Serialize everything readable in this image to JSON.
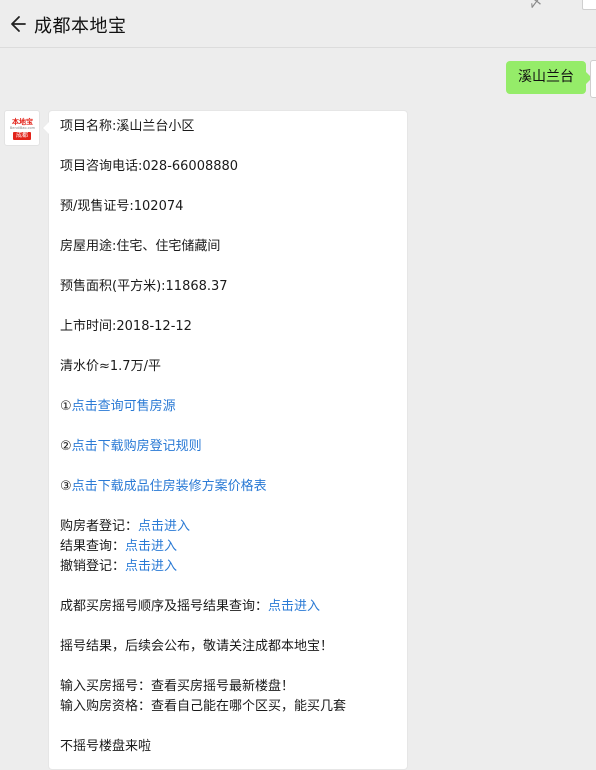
{
  "header": {
    "title": "成都本地宝",
    "back_icon": "back-arrow-icon",
    "top_glyph": "〆"
  },
  "user_message": {
    "text": "溪山兰台"
  },
  "bot": {
    "avatar": {
      "logo_text": "本地宝",
      "logo_url": "BendiBao.com",
      "logo_city": "成都"
    },
    "lines": {
      "name": "项目名称:溪山兰台小区",
      "phone": "项目咨询电话:028-66008880",
      "cert": "预/现售证号:102074",
      "usage": "房屋用途:住宅、住宅储藏间",
      "area": "预售面积(平方米):11868.37",
      "date": "上市时间:2018-12-12",
      "price": "清水价≈1.7万/平"
    },
    "numbered_links": [
      {
        "num": "①",
        "text": "点击查询可售房源"
      },
      {
        "num": "②",
        "text": "点击下载购房登记规则"
      },
      {
        "num": "③",
        "text": "点击下载成品住房装修方案价格表"
      }
    ],
    "registration": [
      {
        "label": "购房者登记：",
        "link": "点击进入"
      },
      {
        "label": "结果查询：",
        "link": "点击进入"
      },
      {
        "label": "撤销登记：",
        "link": "点击进入"
      }
    ],
    "lottery_query": {
      "label": "成都买房摇号顺序及摇号结果查询：",
      "link": "点击进入"
    },
    "notice": "摇号结果，后续会公布，敬请关注成都本地宝！",
    "tips": [
      "输入买房摇号：查看买房摇号最新楼盘！",
      "输入购房资格：查看自己能在哪个区买，能买几套"
    ],
    "footer": "不摇号楼盘来啦"
  },
  "colors": {
    "background": "#ededed",
    "user_bubble": "#95ec69",
    "link": "#2a7ad5",
    "brand_red": "#e2231a"
  }
}
